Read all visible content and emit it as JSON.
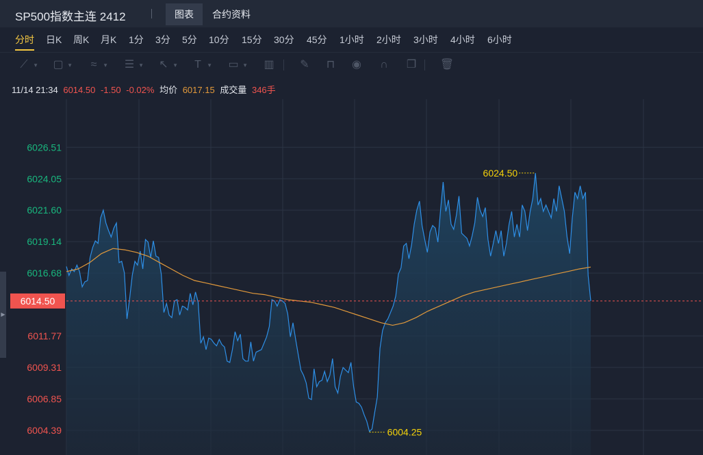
{
  "header": {
    "title": "SP500指数主连 2412",
    "tabs": [
      {
        "label": "图表",
        "active": true
      },
      {
        "label": "合约资料",
        "active": false
      }
    ]
  },
  "periods": [
    {
      "label": "分时",
      "active": true
    },
    {
      "label": "日K",
      "active": false
    },
    {
      "label": "周K",
      "active": false
    },
    {
      "label": "月K",
      "active": false
    },
    {
      "label": "1分",
      "active": false
    },
    {
      "label": "3分",
      "active": false
    },
    {
      "label": "5分",
      "active": false
    },
    {
      "label": "10分",
      "active": false
    },
    {
      "label": "15分",
      "active": false
    },
    {
      "label": "30分",
      "active": false
    },
    {
      "label": "45分",
      "active": false
    },
    {
      "label": "1小时",
      "active": false
    },
    {
      "label": "2小时",
      "active": false
    },
    {
      "label": "3小时",
      "active": false
    },
    {
      "label": "4小时",
      "active": false
    },
    {
      "label": "6小时",
      "active": false
    }
  ],
  "toolbar": [
    {
      "icon": "line-tool-icon",
      "glyph": "⟋",
      "caret": true
    },
    {
      "icon": "rectangle-tool-icon",
      "glyph": "▢",
      "caret": true
    },
    {
      "icon": "wave-tool-icon",
      "glyph": "≈",
      "caret": true
    },
    {
      "icon": "fibonacci-tool-icon",
      "glyph": "☰",
      "caret": true
    },
    {
      "icon": "arrow-tool-icon",
      "glyph": "↖",
      "caret": true
    },
    {
      "icon": "text-tool-icon",
      "glyph": "T",
      "caret": true
    },
    {
      "icon": "label-tool-icon",
      "glyph": "▭",
      "caret": true
    },
    {
      "icon": "measure-tool-icon",
      "glyph": "▥",
      "caret": false
    },
    {
      "icon": "pen-icon",
      "glyph": "✎",
      "caret": false
    },
    {
      "icon": "lock-icon",
      "glyph": "⊓",
      "caret": false
    },
    {
      "icon": "eye-icon",
      "glyph": "◉",
      "caret": false
    },
    {
      "icon": "magnet-icon",
      "glyph": "∩",
      "caret": false
    },
    {
      "icon": "layers-icon",
      "glyph": "❐",
      "caret": false
    },
    {
      "icon": "trash-icon",
      "glyph": "🗑",
      "caret": false
    }
  ],
  "info": {
    "datetime": "11/14 21:34",
    "price": "6014.50",
    "change": "-1.50",
    "change_pct": "-0.02%",
    "avg_label": "均价",
    "avg_value": "6017.15",
    "volume_label": "成交量",
    "volume_value": "346手"
  },
  "colors": {
    "background": "#1c2230",
    "grid": "#2b3444",
    "price_line": "#2e8fe6",
    "avg_line": "#e39a3b",
    "up": "#19b77e",
    "down": "#f0544f",
    "highlight": "#f5d20a"
  },
  "chart_data": {
    "type": "line",
    "y_ticks": [
      "6026.51",
      "6024.05",
      "6021.60",
      "6019.14",
      "6016.68",
      "6014.50",
      "6011.77",
      "6009.31",
      "6006.85",
      "6004.39"
    ],
    "reference_price": 6014.5,
    "last_price_label": "6014.50",
    "ylim": [
      6003.8,
      6029.2
    ],
    "high_label": "6024.50",
    "low_label": "6004.25",
    "high_value": 6024.5,
    "low_value": 6004.25,
    "series": [
      {
        "name": "价格",
        "values": [
          6017.2,
          6016.5,
          6017.0,
          6016.8,
          6017.3,
          6016.8,
          6015.6,
          6016.0,
          6016.1,
          6017.9,
          6018.7,
          6019.2,
          6019.0,
          6021.0,
          6021.6,
          6020.6,
          6020.0,
          6019.5,
          6020.2,
          6020.6,
          6017.5,
          6017.6,
          6016.7,
          6013.1,
          6014.7,
          6016.5,
          6017.6,
          6017.3,
          6018.4,
          6017.0,
          6019.3,
          6019.1,
          6017.9,
          6019.2,
          6018.0,
          6017.9,
          6016.6,
          6013.6,
          6014.3,
          6013.4,
          6013.2,
          6014.5,
          6014.6,
          6013.4,
          6014.1,
          6014.0,
          6013.8,
          6015.1,
          6014.2,
          6015.2,
          6014.4,
          6011.2,
          6011.7,
          6010.7,
          6011.6,
          6011.5,
          6011.2,
          6011.0,
          6011.5,
          6011.1,
          6010.9,
          6009.8,
          6009.7,
          6010.7,
          6012.1,
          6011.4,
          6011.9,
          6010.0,
          6009.8,
          6009.8,
          6011.3,
          6009.8,
          6010.5,
          6010.6,
          6010.7,
          6011.2,
          6011.7,
          6012.5,
          6014.6,
          6014.5,
          6014.1,
          6014.6,
          6014.5,
          6014.3,
          6013.5,
          6011.7,
          6012.8,
          6011.5,
          6010.3,
          6009.1,
          6008.7,
          6008.1,
          6006.9,
          6006.8,
          6009.2,
          6007.8,
          6008.2,
          6008.3,
          6009.0,
          6008.2,
          6008.7,
          6010.0,
          6007.8,
          6007.3,
          6008.6,
          6009.3,
          6009.1,
          6008.9,
          6009.7,
          6007.8,
          6006.6,
          6006.5,
          6006.2,
          6005.6,
          6005.1,
          6004.3,
          6004.5,
          6005.8,
          6007.0,
          6010.8,
          6012.2,
          6012.8,
          6013.1,
          6013.6,
          6014.1,
          6014.9,
          6016.6,
          6017.1,
          6018.8,
          6019.0,
          6017.8,
          6018.9,
          6020.5,
          6021.6,
          6022.3,
          6020.4,
          6019.3,
          6018.3,
          6019.9,
          6020.4,
          6020.2,
          6019.1,
          6021.6,
          6023.8,
          6021.5,
          6022.4,
          6020.5,
          6020.1,
          6021.2,
          6022.7,
          6019.8,
          6019.6,
          6019.4,
          6018.8,
          6019.6,
          6020.6,
          6022.6,
          6021.6,
          6021.1,
          6021.8,
          6019.3,
          6018.0,
          6019.0,
          6020.0,
          6019.0,
          6020.0,
          6018.0,
          6019.0,
          6020.5,
          6021.5,
          6019.5,
          6020.5,
          6019.5,
          6022.0,
          6021.5,
          6020.0,
          6021.5,
          6022.5,
          6024.5,
          6022.0,
          6022.5,
          6021.5,
          6022.0,
          6021.5,
          6021.0,
          6022.5,
          6021.5,
          6023.5,
          6022.5,
          6021.5,
          6019.5,
          6018.2,
          6021.0,
          6023.0,
          6022.5,
          6023.5,
          6022.5,
          6023.0,
          6016.5,
          6014.5
        ]
      },
      {
        "name": "均价",
        "values": [
          6016.8,
          6017.0,
          6017.5,
          6018.2,
          6018.6,
          6018.5,
          6018.3,
          6018.0,
          6017.5,
          6017.0,
          6016.5,
          6016.1,
          6015.9,
          6015.7,
          6015.5,
          6015.3,
          6015.1,
          6015.0,
          6014.8,
          6014.6,
          6014.5,
          6014.4,
          6014.2,
          6014.0,
          6013.7,
          6013.4,
          6013.1,
          6012.8,
          6012.6,
          6012.8,
          6013.2,
          6013.7,
          6014.1,
          6014.5,
          6014.9,
          6015.2,
          6015.4,
          6015.6,
          6015.8,
          6016.0,
          6016.2,
          6016.4,
          6016.6,
          6016.8,
          6017.0,
          6017.15
        ]
      }
    ]
  }
}
